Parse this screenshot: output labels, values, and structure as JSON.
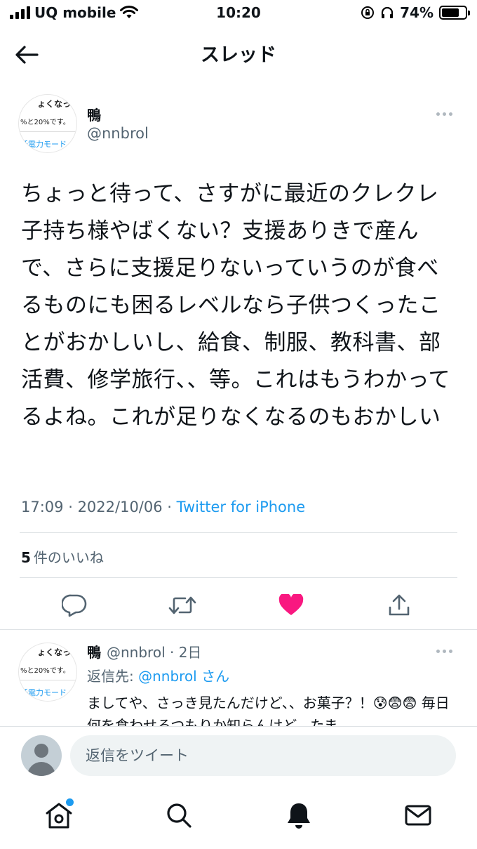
{
  "status_bar": {
    "carrier": "UQ mobile",
    "time": "10:20",
    "battery": "74%",
    "battery_level": 0.74
  },
  "header": {
    "title": "スレッド"
  },
  "main_tweet": {
    "name": "鴨",
    "handle": "@nnbrol",
    "text": "ちょっと待って、さすがに最近のクレクレ子持ち様やばくない？支援ありきで産んで、さらに支援足りないっていうのが食べるものにも困るレベルなら子供つくったことがおかしいし、給食、制服、教科書、部活費、修学旅行、、等。これはもうわかってるよね。これが足りなくなるのもおかしい",
    "time": "17:09",
    "date": "2022/10/06",
    "source": "Twitter for iPhone",
    "like_count": "5",
    "like_label": "件のいいね"
  },
  "avatar_text": {
    "top": "ょくなっ",
    "middle": "%と20%です。",
    "bottom": "低電力モード"
  },
  "reply": {
    "name": "鴨",
    "handle": "@nnbrol",
    "age": "2日",
    "reply_to_prefix": "返信先: ",
    "reply_to_handle": "@nnbrol",
    "reply_to_suffix": "さん",
    "text": "ましてや、さっき見たんだけど、、お菓子？！😰😨😨 毎日何を食わせるつもりか知らんけど、たま"
  },
  "compose": {
    "placeholder": "返信をツイート"
  },
  "colors": {
    "accent": "#1d9bf0",
    "like": "#f91880",
    "secondary_text": "#536471"
  }
}
